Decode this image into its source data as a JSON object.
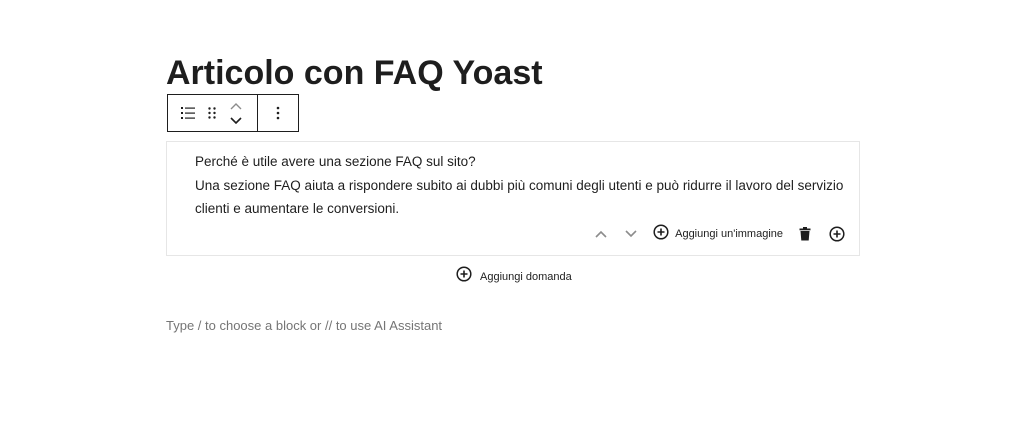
{
  "post": {
    "title": "Articolo con FAQ Yoast"
  },
  "toolbar": {
    "icons": [
      "list-icon",
      "drag-handle-icon",
      "chevron-up-icon",
      "chevron-down-icon",
      "more-vertical-icon"
    ]
  },
  "faq": {
    "question": "Perché è utile avere una sezione FAQ sul sito?",
    "answer": "Una sezione FAQ aiuta a rispondere subito ai dubbi più comuni degli utenti e può ridurre il lavoro del servizio clienti e aumentare le conversioni.",
    "actions": {
      "add_image_label": "Aggiungi un'immagine"
    }
  },
  "add_question_label": "Aggiungi domanda",
  "appender_placeholder": "Type / to choose a block or // to use AI Assistant",
  "colors": {
    "text": "#1e1e1e",
    "placeholder": "#757575",
    "border": "#e6e6e6"
  }
}
